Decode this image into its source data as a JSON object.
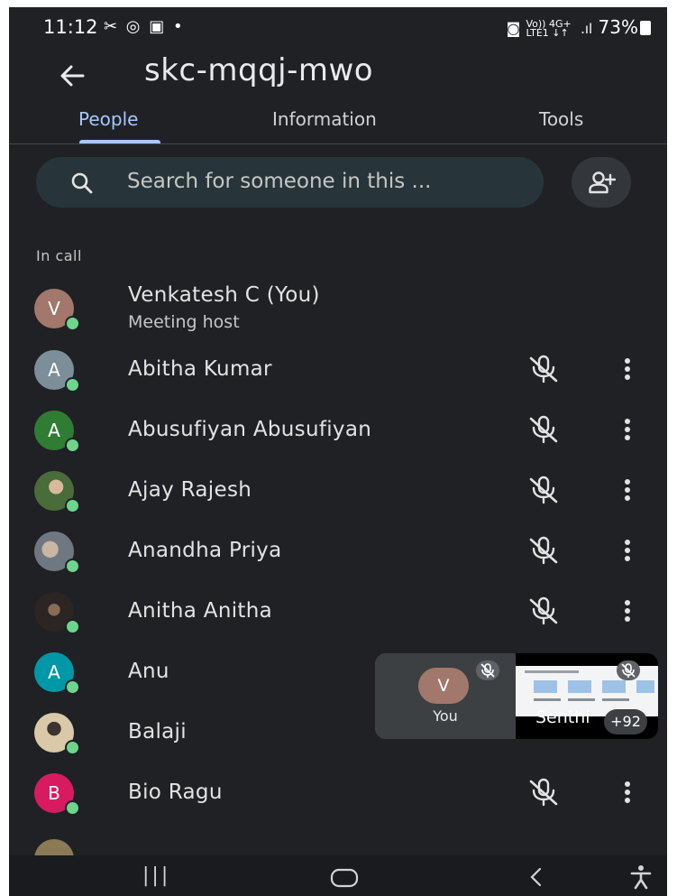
{
  "status": {
    "time": "11:12",
    "net_top": "Vo)) 4G+",
    "net_bottom": "LTE1 ↓↑",
    "battery": "73%"
  },
  "header": {
    "title": "skc-mqqj-mwo"
  },
  "tabs": [
    {
      "label": "People",
      "active": true
    },
    {
      "label": "Information",
      "active": false
    },
    {
      "label": "Tools",
      "active": false
    }
  ],
  "search": {
    "placeholder": "Search for someone in this ..."
  },
  "section_label": "In call",
  "people": [
    {
      "name": "Venkatesh C (You)",
      "subtitle": "Meeting host",
      "initial": "V",
      "color": "#a1786b"
    },
    {
      "name": "Abitha Kumar",
      "initial": "A",
      "color": "#7c8f99"
    },
    {
      "name": "Abusufiyan Abusufiyan",
      "initial": "A",
      "color": "#2e7d32"
    },
    {
      "name": "Ajay Rajesh",
      "initial": "",
      "color": "#6b7f5a"
    },
    {
      "name": "Anandha Priya",
      "initial": "",
      "color": "#8a8f96"
    },
    {
      "name": "Anitha Anitha",
      "initial": "",
      "color": "#3d3432"
    },
    {
      "name": "Anu",
      "initial": "A",
      "color": "#0097a7"
    },
    {
      "name": "Balaji",
      "initial": "",
      "color": "#b8a58c"
    },
    {
      "name": "Bio Ragu",
      "initial": "B",
      "color": "#d81b60"
    }
  ],
  "pip": {
    "self_initial": "V",
    "self_label": "You",
    "other_name": "Senthi",
    "extra_count": "+92"
  }
}
